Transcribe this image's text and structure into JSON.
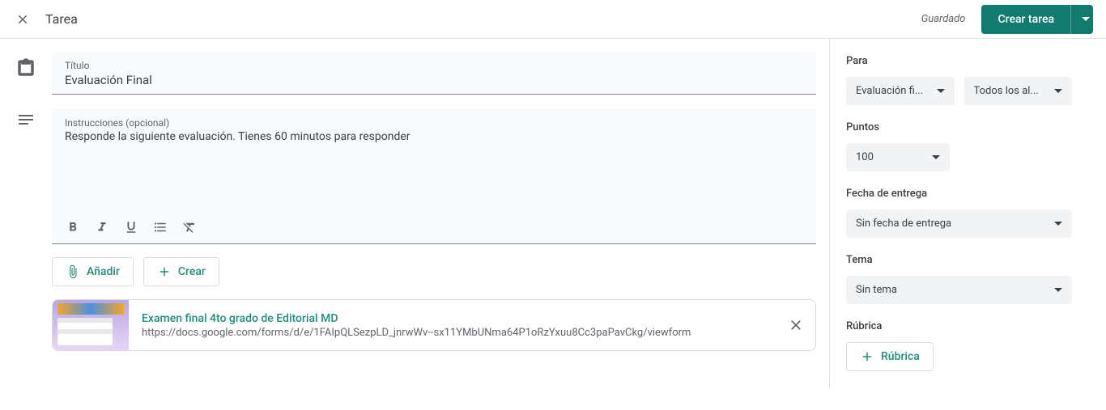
{
  "header": {
    "page_type": "Tarea",
    "saved_text": "Guardado",
    "create_button": "Crear tarea"
  },
  "form": {
    "title_label": "Título",
    "title_value": "Evaluación Final",
    "instructions_label": "Instrucciones (opcional)",
    "instructions_value": "Responde la siguiente evaluación. Tienes 60 minutos para responder"
  },
  "actions": {
    "add": "Añadir",
    "create": "Crear"
  },
  "attachment": {
    "title": "Examen final 4to grado de Editorial MD",
    "url": "https://docs.google.com/forms/d/e/1FAIpQLSezpLD_jnrwWv--sx11YMbUNma64P1oRzYxuu8Cc3paPavCkg/viewform"
  },
  "sidebar": {
    "for_label": "Para",
    "class_value": "Evaluación fi...",
    "students_value": "Todos los al...",
    "points_label": "Puntos",
    "points_value": "100",
    "due_label": "Fecha de entrega",
    "due_value": "Sin fecha de entrega",
    "topic_label": "Tema",
    "topic_value": "Sin tema",
    "rubric_label": "Rúbrica",
    "rubric_button": "Rúbrica"
  }
}
